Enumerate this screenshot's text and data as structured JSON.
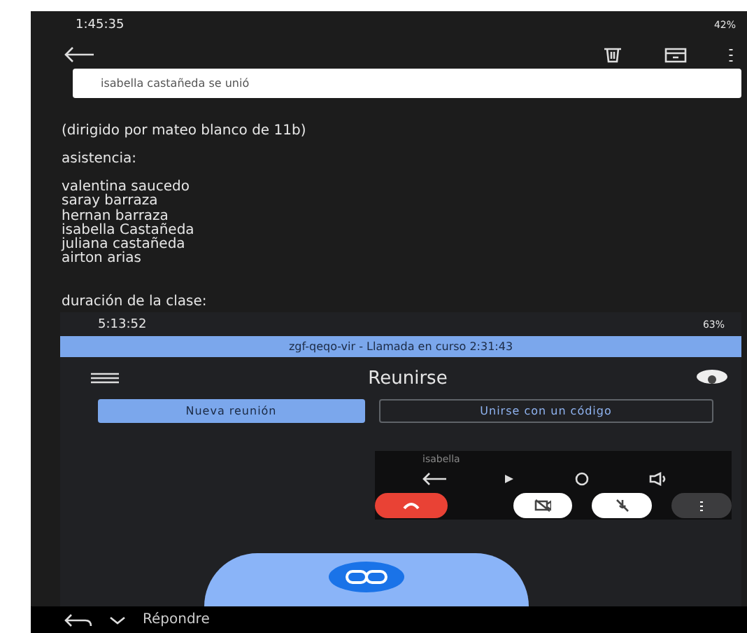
{
  "status_bar": {
    "time": "1:45:35",
    "battery": "42%"
  },
  "notice": "isabella castañeda se unió",
  "body": {
    "note": "(dirigido por mateo blanco de 11b)",
    "heading": "asistencia:",
    "names": [
      "valentina saucedo",
      "saray barraza",
      "hernan barraza",
      "isabella Castañeda",
      "juliana castañeda",
      "airton arias"
    ],
    "footer": "duración de la clase:"
  },
  "inner_screenshot": {
    "status_bar": {
      "time": "5:13:52",
      "battery": "63%"
    },
    "call_banner": "zgf-qeqo-vir - Llamada en curso 2:31:43",
    "title": "Reunirse",
    "buttons": [
      {
        "label": "Nueva reunión",
        "kind": "filled"
      },
      {
        "label": "Unirse con un código",
        "kind": "outlined"
      }
    ],
    "pip": {
      "name": "isabella"
    }
  },
  "reply_bar": {
    "label": "Répondre"
  }
}
